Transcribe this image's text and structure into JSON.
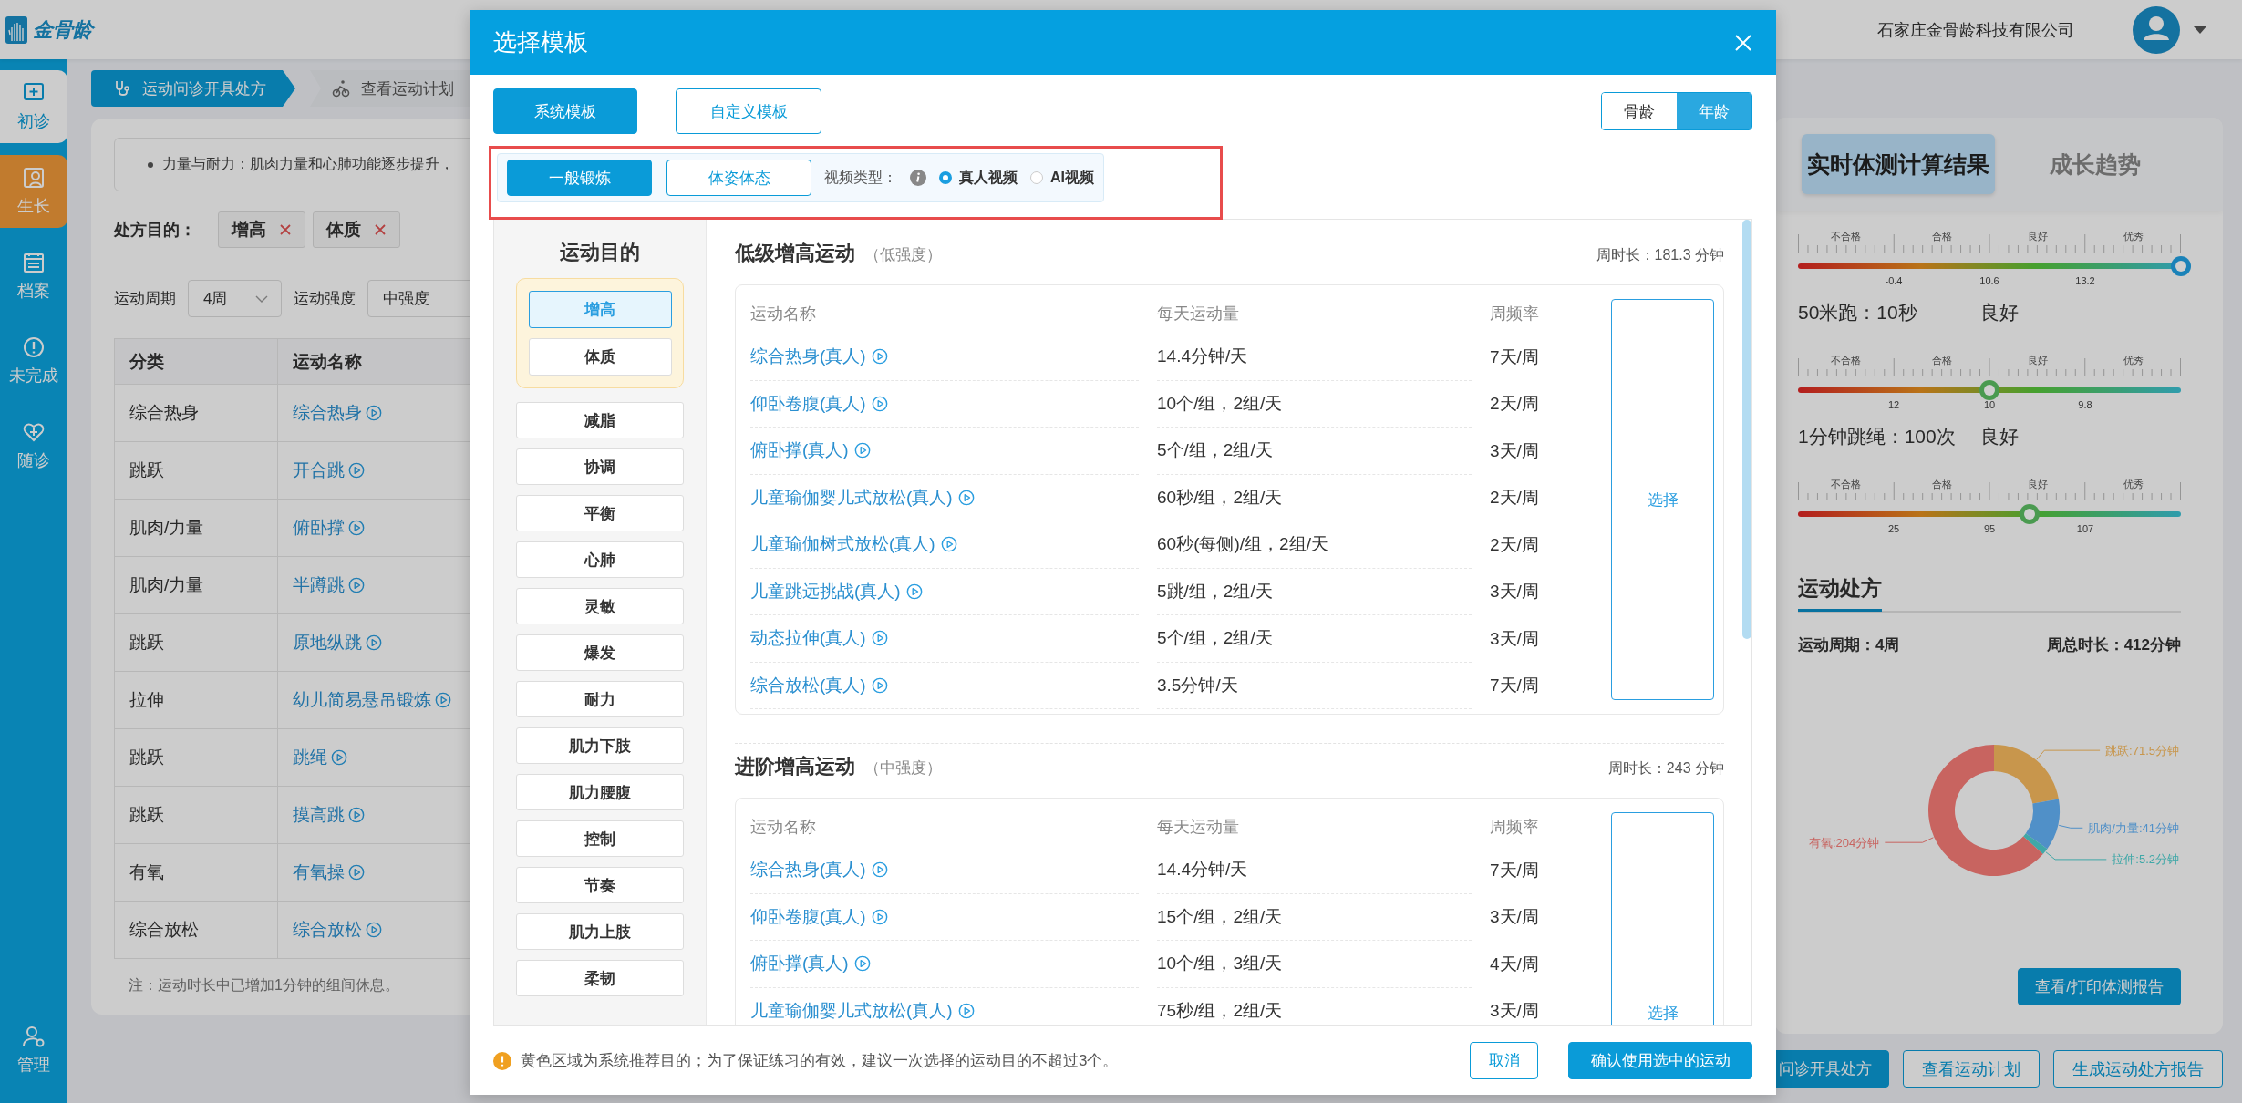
{
  "app": {
    "logo_text": "金骨龄",
    "company": "石家庄金骨龄科技有限公司"
  },
  "sidebar": {
    "items": [
      {
        "label": "初诊",
        "kind": "card",
        "selected": false
      },
      {
        "label": "生长",
        "kind": "plain",
        "selected": true
      },
      {
        "label": "档案",
        "kind": "plain",
        "selected": false
      },
      {
        "label": "未完成",
        "kind": "plain",
        "selected": false
      },
      {
        "label": "随诊",
        "kind": "plain",
        "selected": false
      }
    ],
    "footer_item": {
      "label": "管理"
    }
  },
  "steps": [
    {
      "label": "运动问诊开具处方",
      "selected": true
    },
    {
      "label": "查看运动计划",
      "selected": false
    }
  ],
  "prescription_card": {
    "note": "力量与耐力：肌肉力量和心肺功能逐步提升，",
    "purpose_label": "处方目的：",
    "purpose_tags": [
      "增高",
      "体质"
    ],
    "period_label": "运动周期",
    "period_value": "4周",
    "intensity_label": "运动强度",
    "intensity_value": "中强度",
    "table": {
      "columns": [
        "分类",
        "运动名称"
      ],
      "rows": [
        [
          "综合热身",
          "综合热身"
        ],
        [
          "跳跃",
          "开合跳"
        ],
        [
          "肌肉/力量",
          "俯卧撑"
        ],
        [
          "肌肉/力量",
          "半蹲跳"
        ],
        [
          "跳跃",
          "原地纵跳"
        ],
        [
          "拉伸",
          "幼儿简易悬吊锻炼"
        ],
        [
          "跳跃",
          "跳绳"
        ],
        [
          "跳跃",
          "摸高跳"
        ],
        [
          "有氧",
          "有氧操"
        ],
        [
          "综合放松",
          "综合放松"
        ]
      ]
    },
    "footnote": "注：运动时长中已增加1分钟的组间休息。"
  },
  "results_panel": {
    "tabs": [
      {
        "label": "实时体测计算结果",
        "selected": true
      },
      {
        "label": "成长趋势",
        "selected": false
      }
    ],
    "items": [
      {
        "kind": "gauge",
        "bands": [
          "不合格",
          "合格",
          "良好",
          "优秀"
        ],
        "ticks": [
          "-0.4",
          "10.6",
          "13.2"
        ],
        "level": 1.0,
        "color": "#1a82b8"
      },
      {
        "kind": "result",
        "label": "50米跑：10秒",
        "grade": "良好"
      },
      {
        "kind": "gauge",
        "bands": [
          "不合格",
          "合格",
          "良好",
          "优秀"
        ],
        "ticks": [
          "12",
          "10",
          "9.8"
        ],
        "level": 0.5,
        "color": "#4a9a50"
      },
      {
        "kind": "result",
        "label": "1分钟跳绳：100次",
        "grade": "良好"
      },
      {
        "kind": "gauge",
        "bands": [
          "不合格",
          "合格",
          "良好",
          "优秀"
        ],
        "ticks": [
          "25",
          "95",
          "107"
        ],
        "level": 0.605,
        "color": "#4a9a50"
      }
    ],
    "summary": {
      "title": "运动处方",
      "period": "运动周期：4周",
      "total": "周总时长：412分钟",
      "chart_data": {
        "type": "donut",
        "values": [
          71.5,
          41,
          5.2,
          204
        ],
        "colors": [
          "#fabc5f",
          "#64b4fa",
          "#50d2d2",
          "#fa7d78"
        ],
        "value_labels": [
          "跳跃:71.5分钟",
          "肌肉/力量:41分钟",
          "拉伸:5.2分钟",
          "有氧:204分钟"
        ]
      },
      "report_button": "查看/打印体测报告"
    }
  },
  "bottom_buttons": [
    {
      "label": "问诊开具处方",
      "kind": "primary"
    },
    {
      "label": "查看运动计划",
      "kind": "outline"
    },
    {
      "label": "生成运动处方报告",
      "kind": "outline"
    }
  ],
  "modal": {
    "title": "选择模板",
    "template_tabs": [
      {
        "label": "系统模板",
        "selected": true
      },
      {
        "label": "自定义模板",
        "selected": false
      }
    ],
    "age_toggle": [
      {
        "label": "骨龄",
        "selected": false
      },
      {
        "label": "年龄",
        "selected": true
      }
    ],
    "filter_bar": {
      "highlighted": true,
      "categories": [
        {
          "label": "一般锻炼",
          "selected": true
        },
        {
          "label": "体姿体态",
          "selected": false
        }
      ],
      "video_type_label": "视频类型：",
      "video_types": [
        {
          "label": "真人视频",
          "selected": true
        },
        {
          "label": "AI视频",
          "selected": false
        }
      ]
    },
    "purpose_title": "运动目的",
    "recommended_purposes": [
      {
        "label": "增高",
        "selected": true
      },
      {
        "label": "体质",
        "selected": false
      }
    ],
    "other_purposes": [
      {
        "label": "减脂",
        "selected": false
      },
      {
        "label": "协调",
        "selected": false
      },
      {
        "label": "平衡",
        "selected": false
      },
      {
        "label": "心肺",
        "selected": false
      },
      {
        "label": "灵敏",
        "selected": false
      },
      {
        "label": "爆发",
        "selected": false
      },
      {
        "label": "耐力",
        "selected": false
      },
      {
        "label": "肌力下肢",
        "selected": false
      },
      {
        "label": "肌力腰腹",
        "selected": false
      },
      {
        "label": "控制",
        "selected": false
      },
      {
        "label": "节奏",
        "selected": false
      },
      {
        "label": "肌力上肢",
        "selected": false
      },
      {
        "label": "柔韧",
        "selected": false
      }
    ],
    "sections": [
      {
        "title": "低级增高运动",
        "intensity": "（低强度）",
        "weekly": "周时长：181.3 分钟",
        "columns": [
          "运动名称",
          "每天运动量",
          "周频率"
        ],
        "select_button": "选择",
        "rows": [
          {
            "name": "综合热身(真人)",
            "amount": "14.4分钟/天",
            "frequency": "7天/周"
          },
          {
            "name": "仰卧卷腹(真人)",
            "amount": "10个/组，2组/天",
            "frequency": "2天/周"
          },
          {
            "name": "俯卧撑(真人)",
            "amount": "5个/组，2组/天",
            "frequency": "3天/周"
          },
          {
            "name": "儿童瑜伽婴儿式放松(真人)",
            "amount": "60秒/组，2组/天",
            "frequency": "2天/周"
          },
          {
            "name": "儿童瑜伽树式放松(真人)",
            "amount": "60秒(每侧)/组，2组/天",
            "frequency": "2天/周"
          },
          {
            "name": "儿童跳远挑战(真人)",
            "amount": "5跳/组，2组/天",
            "frequency": "3天/周"
          },
          {
            "name": "动态拉伸(真人)",
            "amount": "5个/组，2组/天",
            "frequency": "3天/周"
          },
          {
            "name": "综合放松(真人)",
            "amount": "3.5分钟/天",
            "frequency": "7天/周"
          }
        ]
      },
      {
        "title": "进阶增高运动",
        "intensity": "（中强度）",
        "weekly": "周时长：243 分钟",
        "columns": [
          "运动名称",
          "每天运动量",
          "周频率"
        ],
        "select_button": "选择",
        "rows": [
          {
            "name": "综合热身(真人)",
            "amount": "14.4分钟/天",
            "frequency": "7天/周"
          },
          {
            "name": "仰卧卷腹(真人)",
            "amount": "15个/组，2组/天",
            "frequency": "3天/周"
          },
          {
            "name": "俯卧撑(真人)",
            "amount": "10个/组，3组/天",
            "frequency": "4天/周"
          },
          {
            "name": "儿童瑜伽婴儿式放松(真人)",
            "amount": "75秒/组，2组/天",
            "frequency": "3天/周"
          }
        ]
      }
    ],
    "footer_note": "黄色区域为系统推荐目的；为了保证练习的有效，建议一次选择的运动目的不超过3个。",
    "cancel_button": "取消",
    "confirm_button": "确认使用选中的运动"
  }
}
